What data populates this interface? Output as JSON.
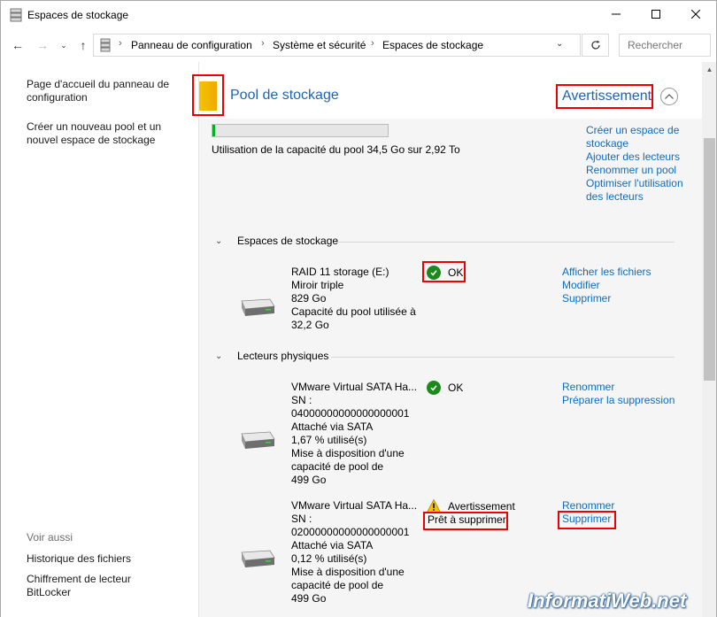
{
  "window": {
    "title": "Espaces de stockage"
  },
  "address": {
    "crumbs": [
      "Panneau de configuration",
      "Système et sécurité",
      "Espaces de stockage"
    ],
    "search_placeholder": "Rechercher"
  },
  "sidebar": {
    "links": [
      "Page d'accueil du panneau de configuration",
      "Créer un nouveau pool et un nouvel espace de stockage"
    ],
    "see_also_heading": "Voir aussi",
    "see_also": [
      "Historique des fichiers",
      "Chiffrement de lecteur BitLocker"
    ]
  },
  "pool": {
    "title": "Pool de stockage",
    "status": "Avertissement",
    "usage_text": "Utilisation de la capacité du pool 34,5 Go sur 2,92 To",
    "usage_fraction": 0.012,
    "actions": [
      "Créer un espace de stockage",
      "Ajouter des lecteurs",
      "Renommer un pool",
      "Optimiser l'utilisation des lecteurs"
    ]
  },
  "spaces": {
    "heading": "Espaces de stockage",
    "items": [
      {
        "name": "RAID 11 storage (E:)",
        "lines": [
          "Miroir triple",
          "829 Go",
          "Capacité du pool utilisée à 32,2 Go"
        ],
        "status": "OK",
        "actions": [
          "Afficher les fichiers",
          "Modifier",
          "Supprimer"
        ]
      }
    ]
  },
  "drives": {
    "heading": "Lecteurs physiques",
    "items": [
      {
        "name": "VMware Virtual SATA Ha...",
        "lines": [
          "SN :",
          "04000000000000000001",
          "Attaché via SATA",
          "1,67 % utilisé(s)",
          "Mise à disposition d'une capacité de pool de",
          "499 Go"
        ],
        "status": "OK",
        "actions": [
          "Renommer",
          "Préparer la suppression"
        ]
      },
      {
        "name": "VMware Virtual SATA Ha...",
        "lines": [
          "SN :",
          "02000000000000000001",
          "Attaché via SATA",
          "0,12 % utilisé(s)",
          "Mise à disposition d'une capacité de pool de",
          "499 Go"
        ],
        "status": "Avertissement",
        "substatus": "Prêt à supprimer",
        "actions": [
          "Renommer",
          "Supprimer"
        ]
      }
    ]
  },
  "watermark": "InformatiWeb.net",
  "colors": {
    "link": "#0f6cbd",
    "highlight": "#e00000",
    "ok": "#1b8a1b",
    "warning": "#f5c400"
  }
}
